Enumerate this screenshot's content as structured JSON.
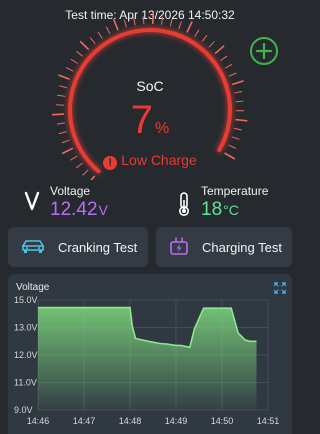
{
  "header": {
    "test_time": "Test time: Apr 13/2026 14:50:32"
  },
  "soc": {
    "label": "SoC",
    "value": "7",
    "unit": "%",
    "status": "Low Charge",
    "gauge_fraction": 0.07
  },
  "metrics": {
    "voltage": {
      "label": "Voltage",
      "value": "12.42",
      "unit": "V"
    },
    "temperature": {
      "label": "Temperature",
      "value": "18",
      "unit": "°C"
    }
  },
  "actions": {
    "cranking_label": "Cranking Test",
    "charging_label": "Charging Test"
  },
  "colors": {
    "background": "#262a2f",
    "accent_red": "#e83b33",
    "voltage_purple": "#b86ef0",
    "temperature_green": "#5fe39a",
    "chart_line": "#8ee68e",
    "add_button_green": "#3fb54a"
  },
  "chart_data": {
    "type": "area",
    "title": "Voltage",
    "x_ticks": [
      "14:46",
      "14:47",
      "14:48",
      "14:49",
      "14:50",
      "14:51"
    ],
    "y_ticks": [
      "15.0V",
      "13.0V",
      "12.0V",
      "11.0V",
      "9.0V"
    ],
    "x_minutes": [
      0,
      1.1,
      2.0,
      2.05,
      2.12,
      2.4,
      2.65,
      2.8,
      3.0,
      3.1,
      3.3,
      3.4,
      3.6,
      3.8,
      3.95,
      4.2,
      4.35,
      4.5,
      4.6,
      4.75
    ],
    "y": [
      14.45,
      14.45,
      14.45,
      13.1,
      12.6,
      12.5,
      12.42,
      12.4,
      12.35,
      12.35,
      12.28,
      12.95,
      14.4,
      14.4,
      14.4,
      14.4,
      12.8,
      12.55,
      12.5,
      12.5
    ],
    "x_start": "14:46"
  }
}
